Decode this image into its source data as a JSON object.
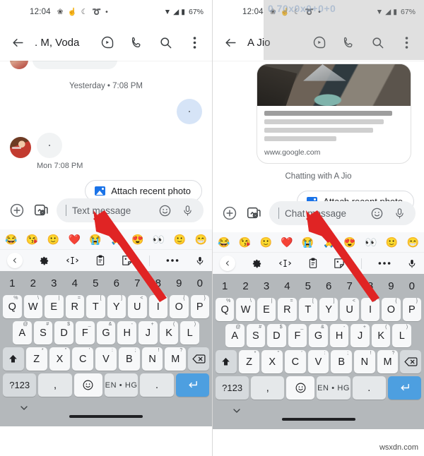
{
  "meta": {
    "watermark": "wsxdn.com"
  },
  "status_bar": {
    "time": "12:04",
    "notification_icons": [
      "weather-icon",
      "hand-icon",
      "moon-icon",
      "swirl-icon",
      "dot-icon"
    ],
    "wifi_icon": "wifi-icon",
    "signal_icon": "signal-icon",
    "battery_icon": "battery-icon",
    "battery_level": "67%"
  },
  "panels": [
    {
      "id": "left",
      "app_bar": {
        "back_icon": "back-arrow-icon",
        "title": ". M, Voda",
        "actions": [
          "video-call-icon",
          "phone-call-icon",
          "search-icon",
          "more-vertical-icon"
        ]
      },
      "conversation": {
        "daystamp": "Yesterday • 7:08 PM",
        "timestamp": "Mon 7:08 PM",
        "outgoing_bubble": "redacted-bubble",
        "incoming_bubble": "redacted-bubble",
        "avatar": "contact-avatar"
      },
      "suggestion_chip": {
        "label": "Attach recent photo",
        "icon": "photo-icon"
      },
      "composer": {
        "plus_icon": "plus-circle-icon",
        "gallery_icon": "gallery-camera-icon",
        "placeholder": "Text message",
        "emoji_icon": "emoji-smiley-icon",
        "mic_icon": "microphone-icon"
      }
    },
    {
      "id": "right",
      "app_bar": {
        "back_icon": "back-arrow-icon",
        "title": "A Jio",
        "actions": [
          "video-call-icon",
          "phone-call-icon",
          "search-icon",
          "more-vertical-icon"
        ]
      },
      "link_card": {
        "image": "mountain-lake-photo",
        "url": "www.google.com",
        "redacted_lines": 4
      },
      "chat_status": "Chatting with A Jio",
      "suggestion_chip": {
        "label": "Attach recent photo",
        "icon": "photo-icon"
      },
      "composer": {
        "plus_icon": "plus-circle-icon",
        "gallery_icon": "gallery-camera-icon",
        "placeholder": "Chat message",
        "emoji_icon": "emoji-smiley-icon",
        "mic_icon": "microphone-icon"
      }
    }
  ],
  "keyboard": {
    "emoji_strip": [
      "😂",
      "😘",
      "🙂",
      "❤️",
      "😭",
      "🙏",
      "😍",
      "👀",
      "🙂",
      "😁"
    ],
    "toolbar": {
      "back_icon": "chevron-left-icon",
      "settings_icon": "gear-icon",
      "cursor_icon": "text-cursor-move-icon",
      "clipboard_icon": "clipboard-icon",
      "sticker_icon": "sticker-icon",
      "more_icon": "more-horizontal-icon",
      "voice_icon": "microphone-icon"
    },
    "number_row": [
      "1",
      "2",
      "3",
      "4",
      "5",
      "6",
      "7",
      "8",
      "9",
      "0"
    ],
    "row1": [
      {
        "key": "Q",
        "sup": "%"
      },
      {
        "key": "W",
        "sup": "\\"
      },
      {
        "key": "E",
        "sup": "|"
      },
      {
        "key": "R",
        "sup": "="
      },
      {
        "key": "T",
        "sup": "["
      },
      {
        "key": "Y",
        "sup": "]"
      },
      {
        "key": "U",
        "sup": "<"
      },
      {
        "key": "I",
        "sup": ">"
      },
      {
        "key": "O",
        "sup": "{"
      },
      {
        "key": "P",
        "sup": "}"
      }
    ],
    "row2": [
      {
        "key": "A",
        "sup": "@"
      },
      {
        "key": "S",
        "sup": "#"
      },
      {
        "key": "D",
        "sup": "$"
      },
      {
        "key": "F",
        "sup": "_"
      },
      {
        "key": "G",
        "sup": "&"
      },
      {
        "key": "H",
        "sup": "-"
      },
      {
        "key": "J",
        "sup": "+"
      },
      {
        "key": "K",
        "sup": "("
      },
      {
        "key": "L",
        "sup": ")"
      }
    ],
    "row3": [
      {
        "key": "Z",
        "sup": "*"
      },
      {
        "key": "X",
        "sup": "\""
      },
      {
        "key": "C",
        "sup": "'"
      },
      {
        "key": "V",
        "sup": ":"
      },
      {
        "key": "B",
        "sup": ";"
      },
      {
        "key": "N",
        "sup": "!"
      },
      {
        "key": "M",
        "sup": "?"
      }
    ],
    "shift_icon": "shift-up-icon",
    "backspace_icon": "backspace-icon",
    "row4": {
      "symbols_label": "?123",
      "comma_label": ",",
      "emoji_icon": "emoji-key-icon",
      "space_label": "EN • HG",
      "period_label": ".",
      "enter_icon": "enter-return-icon"
    },
    "nav": {
      "hide_icon": "chevron-down-icon",
      "home_pill": "home-gesture-pill"
    }
  },
  "colors": {
    "accent_blue": "#4d9fe0",
    "chip_icon_blue": "#1a73e8",
    "outgoing_bubble": "#d6e4f7",
    "incoming_bubble": "#f1f3f4",
    "keyboard_bg": "#b4b8bb",
    "key_bg": "#f7f8f9",
    "annotation_arrow": "#e02424"
  }
}
